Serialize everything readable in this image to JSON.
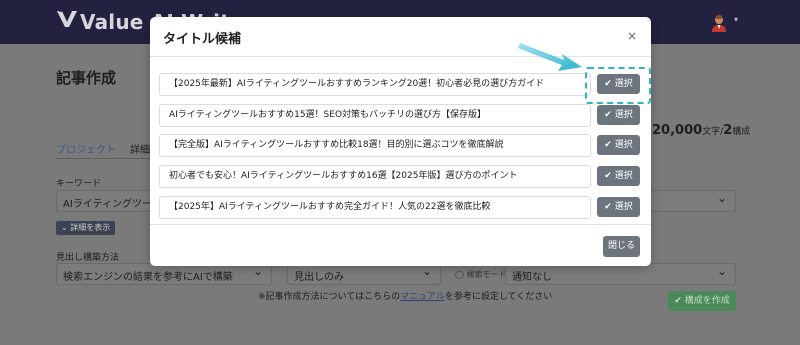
{
  "app": {
    "logo_text": "Value AI Writer"
  },
  "page": {
    "title": "記事作成",
    "tabs": [
      "プロジェクト",
      "詳細"
    ],
    "keyword_label": "キーワード",
    "keyword_value": "AIライティングツールおすすめ",
    "detail_button": "詳細を表示",
    "heading_method_label": "見出し構築方法",
    "heading_method_value": "検索エンジンの結果を参考にAIで構築",
    "heading_only_value": "見出しのみ",
    "search_mode_label": "検索モード",
    "notify_value": "通知なし",
    "count_number": "20,000",
    "count_unit": "文字/",
    "count_num2": "2",
    "count_suffix": "構成",
    "note_prefix": "※記事作成方法についてはこちらの",
    "note_link": "マニュアル",
    "note_suffix": "を参考に設定してください",
    "create_button": "構成を作成"
  },
  "modal": {
    "title": "タイトル候補",
    "close_icon": "×",
    "select_label": "選択",
    "close_button": "閉じる",
    "candidates": [
      "【2025年最新】AIライティングツールおすすめランキング20選！初心者必見の選び方ガイド",
      "AIライティングツールおすすめ15選！SEO対策もバッチリの選び方【保存版】",
      "【完全版】AIライティングツールおすすめ比較18選！目的別に選ぶコツを徹底解説",
      "初心者でも安心！AIライティングツールおすすめ16選【2025年版】選び方のポイント",
      "【2025年】AIライティングツールおすすめ完全ガイド！人気の22選を徹底比較"
    ]
  },
  "colors": {
    "accent": "#2fb4cc",
    "button_gray": "#6c757d",
    "topbar": "#222240",
    "create_green": "#4b8a58"
  },
  "icons": {
    "check": "check-icon",
    "user": "user-avatar-icon",
    "close": "close-icon"
  }
}
